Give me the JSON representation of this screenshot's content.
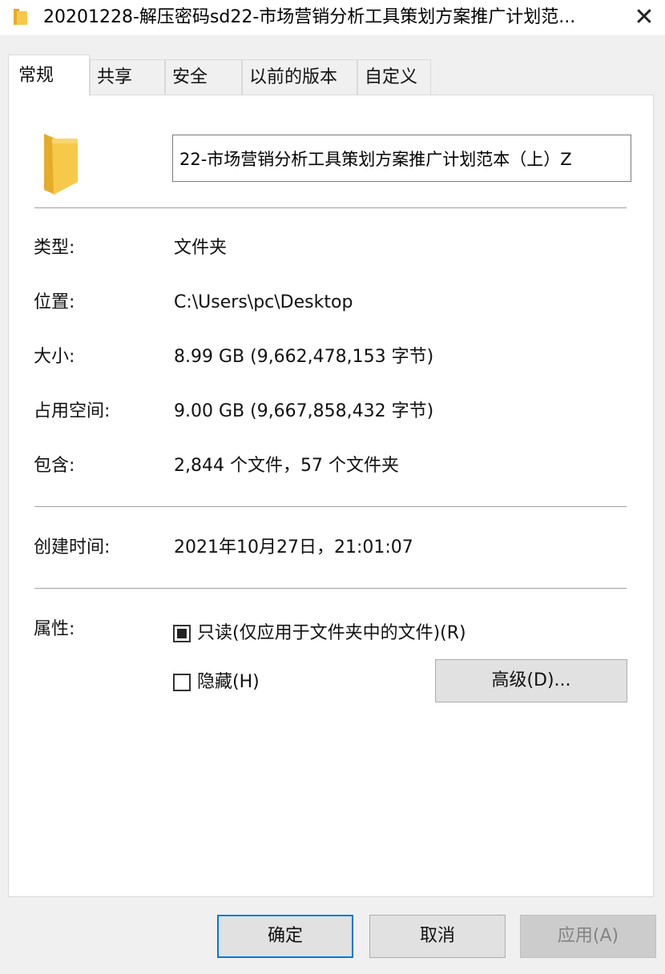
{
  "window": {
    "title": "20201228-解压密码sd22-市场营销分析工具策划方案推广计划范...",
    "close_glyph": "✕"
  },
  "tabs": [
    {
      "label": "常规",
      "active": true
    },
    {
      "label": "共享",
      "active": false
    },
    {
      "label": "安全",
      "active": false
    },
    {
      "label": "以前的版本",
      "active": false
    },
    {
      "label": "自定义",
      "active": false
    }
  ],
  "general": {
    "folder_name": "22-市场营销分析工具策划方案推广计划范本（上）Z",
    "type_label": "类型:",
    "type_value": "文件夹",
    "location_label": "位置:",
    "location_value": "C:\\Users\\pc\\Desktop",
    "size_label": "大小:",
    "size_value": "8.99 GB (9,662,478,153 字节)",
    "size_on_disk_label": "占用空间:",
    "size_on_disk_value": "9.00 GB (9,667,858,432 字节)",
    "contains_label": "包含:",
    "contains_value": "2,844 个文件，57 个文件夹",
    "created_label": "创建时间:",
    "created_value": "2021年10月27日，21:01:07",
    "attributes_label": "属性:",
    "readonly_label": "只读(仅应用于文件夹中的文件)(R)",
    "hidden_label": "隐藏(H)",
    "advanced_label": "高级(D)..."
  },
  "buttons": {
    "ok": "确定",
    "cancel": "取消",
    "apply": "应用(A)"
  },
  "colors": {
    "folder_yellow": "#f7c94a",
    "folder_shadow": "#e3ad2a",
    "focus_blue": "#0078d7"
  }
}
